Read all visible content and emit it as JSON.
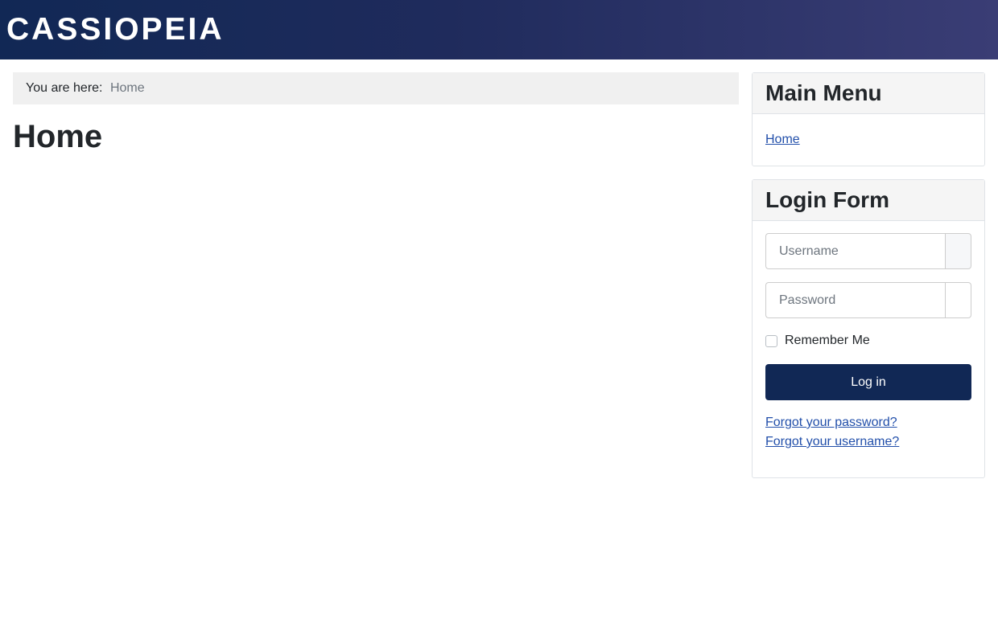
{
  "header": {
    "brand": "CASSIOPEIA",
    "gradient_start": "#112855",
    "gradient_end": "#3a3d75"
  },
  "breadcrumb": {
    "prefix": "You are here:",
    "items": [
      "Home"
    ]
  },
  "main": {
    "title": "Home"
  },
  "main_menu": {
    "title": "Main Menu",
    "items": [
      {
        "label": "Home"
      }
    ]
  },
  "login_form": {
    "title": "Login Form",
    "username_placeholder": "Username",
    "password_placeholder": "Password",
    "remember_label": "Remember Me",
    "remember_checked": false,
    "submit_label": "Log in",
    "forgot_password": "Forgot your password?",
    "forgot_username": "Forgot your username?",
    "button_color": "#112855",
    "link_color": "#224faa"
  }
}
